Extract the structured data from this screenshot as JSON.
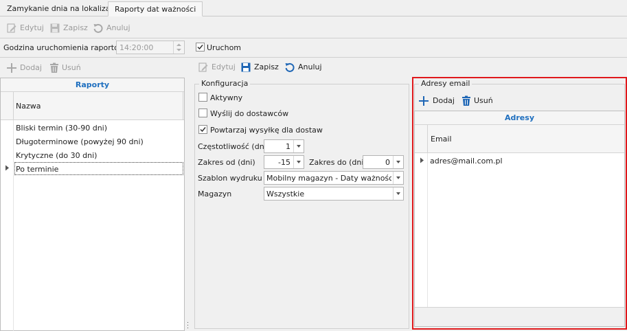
{
  "tabs": [
    {
      "label": "Zamykanie dnia na lokalizacji",
      "active": false
    },
    {
      "label": "Raporty dat ważności",
      "active": true
    }
  ],
  "main_toolbar": {
    "edit": "Edytuj",
    "save": "Zapisz",
    "cancel": "Anuluj"
  },
  "schedule": {
    "time_label": "Godzina uruchomienia raportów",
    "time_value": "14:20:00",
    "run_label": "Uruchom",
    "run_checked": true
  },
  "reports_toolbar": {
    "add": "Dodaj",
    "remove": "Usuń"
  },
  "reports_grid": {
    "title": "Raporty",
    "column": "Nazwa",
    "rows": [
      "Bliski termin (30-90 dni)",
      "Długoterminowe (powyżej 90 dni)",
      "Krytyczne (do 30 dni)",
      "Po terminie"
    ],
    "selected_index": 3
  },
  "detail_toolbar": {
    "edit": "Edytuj",
    "save": "Zapisz",
    "cancel": "Anuluj"
  },
  "config": {
    "title": "Konfiguracja",
    "active_label": "Aktywny",
    "active_checked": false,
    "send_suppliers_label": "Wyślij do dostawców",
    "send_suppliers_checked": false,
    "repeat_label": "Powtarzaj wysyłkę dla dostaw",
    "repeat_checked": true,
    "frequency_label": "Częstotliwość (dni)",
    "frequency_value": "1",
    "range_from_label": "Zakres od (dni)",
    "range_from_value": "-15",
    "range_to_label": "Zakres do (dni)",
    "range_to_value": "0",
    "template_label": "Szablon wydruku",
    "template_value": "Mobilny magazyn - Daty ważności (...",
    "warehouse_label": "Magazyn",
    "warehouse_value": "Wszystkie"
  },
  "emails": {
    "title": "Adresy email",
    "add": "Dodaj",
    "remove": "Usuń",
    "grid_title": "Adresy",
    "column": "Email",
    "rows": [
      "adres@mail.com.pl"
    ]
  },
  "colors": {
    "accent": "#1f6fbf",
    "highlight": "#e0181b",
    "grid_title": "#1f6fbf"
  },
  "icons": {
    "edit": "pencil-icon",
    "save": "floppy-icon",
    "cancel": "undo-icon",
    "add": "plus-icon",
    "remove": "trash-icon",
    "row_pointer": "triangle-right-icon"
  }
}
